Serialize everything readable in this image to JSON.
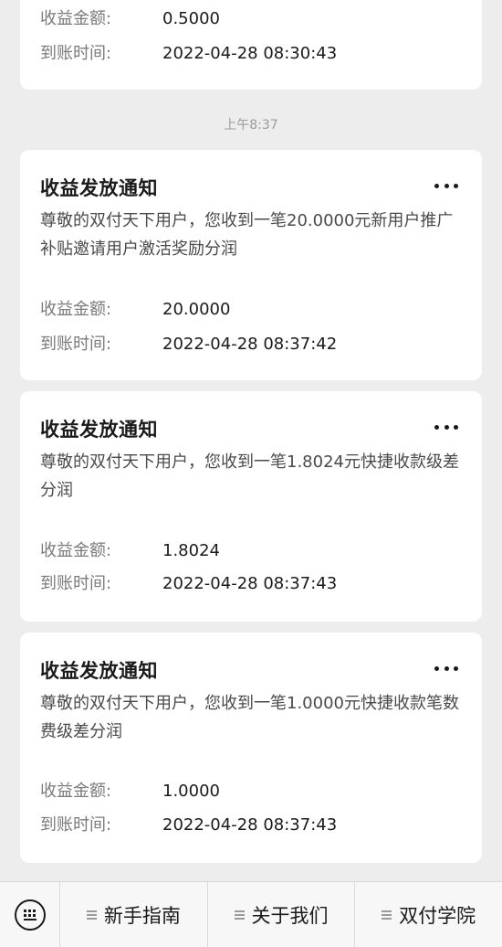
{
  "partial_card": {
    "amount_label": "收益金额:",
    "amount_value": "0.5000",
    "time_label": "到账时间:",
    "time_value": "2022-04-28 08:30:43"
  },
  "timestamp": "上午8:37",
  "cards": [
    {
      "title": "收益发放通知",
      "body": "尊敬的双付天下用户，您收到一笔20.0000元新用户推广补贴邀请用户激活奖励分润",
      "amount_label": "收益金额:",
      "amount_value": "20.0000",
      "time_label": "到账时间:",
      "time_value": "2022-04-28 08:37:42"
    },
    {
      "title": "收益发放通知",
      "body": "尊敬的双付天下用户，您收到一笔1.8024元快捷收款级差分润",
      "amount_label": "收益金额:",
      "amount_value": "1.8024",
      "time_label": "到账时间:",
      "time_value": "2022-04-28 08:37:43"
    },
    {
      "title": "收益发放通知",
      "body": "尊敬的双付天下用户，您收到一笔1.0000元快捷收款笔数费级差分润",
      "amount_label": "收益金额:",
      "amount_value": "1.0000",
      "time_label": "到账时间:",
      "time_value": "2022-04-28 08:37:43"
    }
  ],
  "bottom_menu": {
    "keyboard_icon": "keyboard-icon",
    "items": [
      {
        "label": "新手指南",
        "icon": "menu-list-icon"
      },
      {
        "label": "关于我们",
        "icon": "menu-list-icon"
      },
      {
        "label": "双付学院",
        "icon": "menu-list-icon"
      }
    ]
  }
}
